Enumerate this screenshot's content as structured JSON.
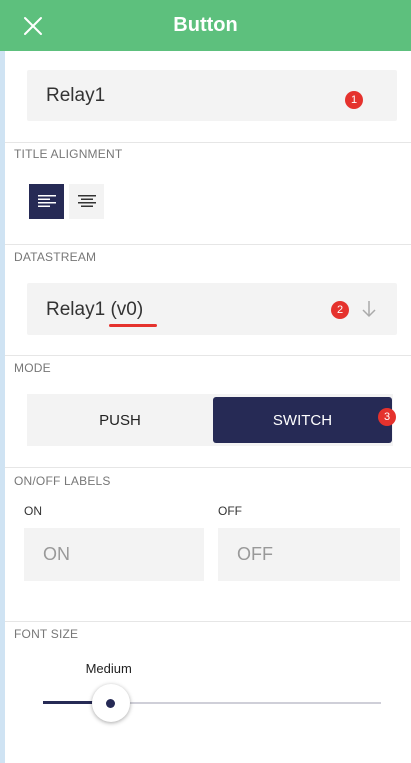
{
  "colors": {
    "header_bg": "#5dc07d",
    "navy": "#262a55",
    "badge": "#e5322d",
    "underline": "#e5322d"
  },
  "header": {
    "title": "Button",
    "close_icon": "close-icon"
  },
  "name_field": {
    "value": "Relay1",
    "badge": "1"
  },
  "title_alignment": {
    "label": "TITLE ALIGNMENT",
    "options": [
      "align-left-icon",
      "align-center-icon"
    ],
    "selected": "align-left"
  },
  "datastream": {
    "label": "DATASTREAM",
    "name": "Relay1",
    "pin": "(v0)",
    "badge": "2",
    "icon": "arrow-down-icon"
  },
  "mode": {
    "label": "MODE",
    "push_label": "PUSH",
    "switch_label": "SWITCH",
    "selected": "SWITCH",
    "badge": "3"
  },
  "onoff_labels": {
    "label": "ON/OFF LABELS",
    "on_caption": "ON",
    "on_placeholder": "ON",
    "off_caption": "OFF",
    "off_placeholder": "OFF"
  },
  "font_size": {
    "label": "FONT SIZE",
    "value_label": "Medium",
    "level": 0.2
  }
}
